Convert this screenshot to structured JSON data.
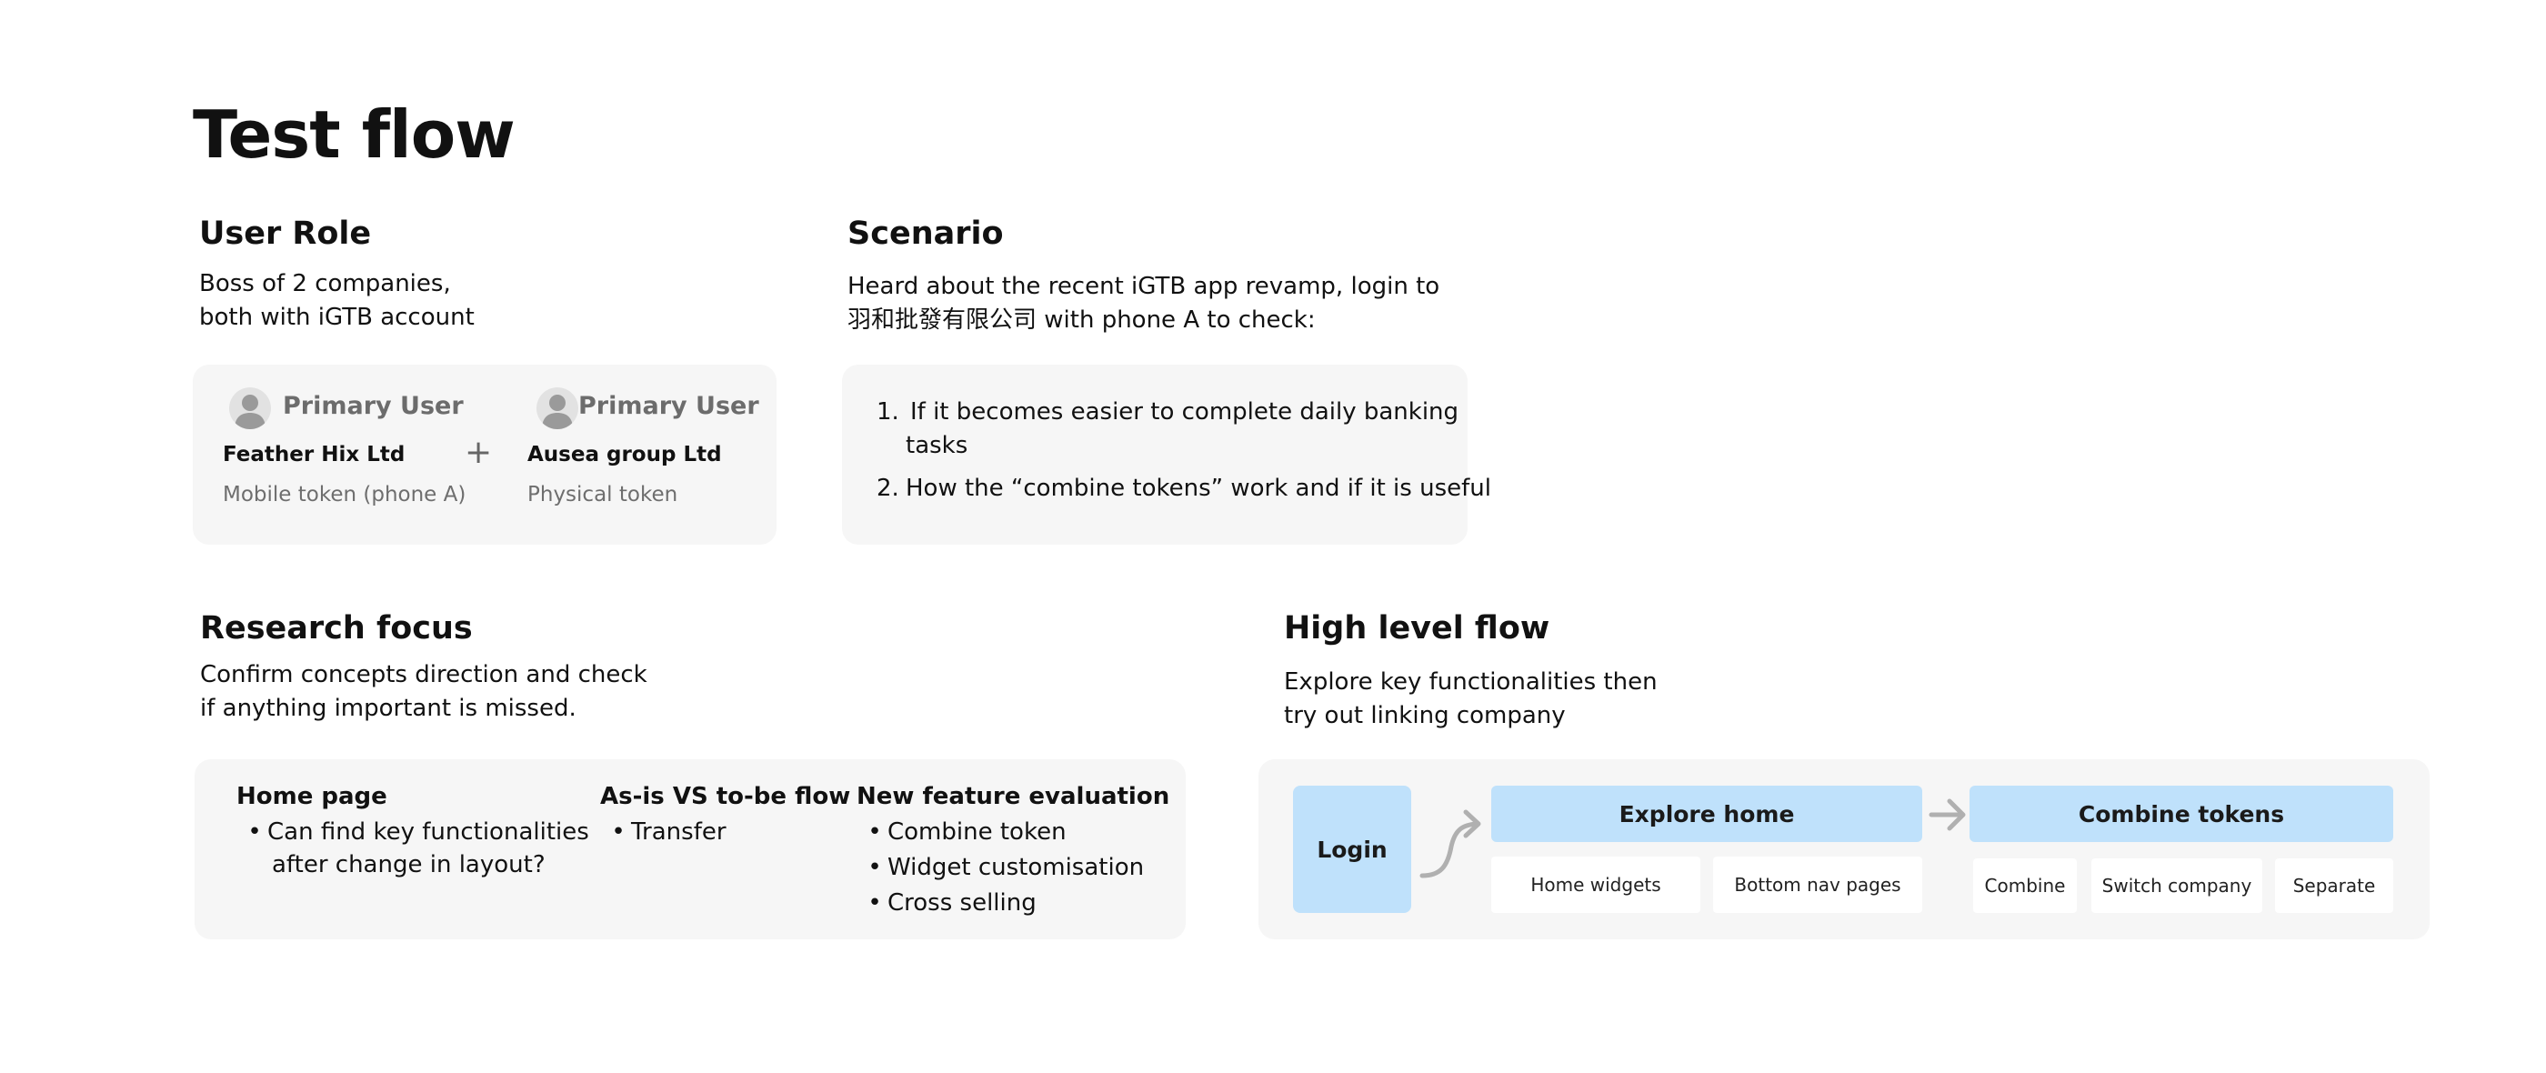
{
  "page": {
    "title": "Test flow"
  },
  "user_role": {
    "heading": "User Role",
    "description_line1": "Boss of 2 companies,",
    "description_line2": "both with iGTB account",
    "plus": "+",
    "users": [
      {
        "role": "Primary User",
        "company": "Feather Hix Ltd",
        "token": "Mobile token (phone A)"
      },
      {
        "role": "Primary User",
        "company": "Ausea group Ltd",
        "token": "Physical token"
      }
    ]
  },
  "scenario": {
    "heading": "Scenario",
    "description_line1": "Heard about the recent iGTB app revamp, login to",
    "description_line2": "羽和批發有限公司 with phone A  to check:",
    "items": [
      {
        "number": "1.",
        "line1": "If it becomes easier to complete daily banking",
        "line2": "tasks"
      },
      {
        "number": "2.",
        "line1": "How the “combine tokens” work and if it is useful"
      }
    ]
  },
  "research_focus": {
    "heading": "Research focus",
    "description_line1": "Confirm concepts direction and check",
    "description_line2": "if anything important is missed.",
    "bullet_char": "•",
    "columns": [
      {
        "title": "Home page",
        "items": [
          "Can find key functionalities",
          "after change in layout?"
        ]
      },
      {
        "title": "As-is VS to-be flow",
        "items": [
          "Transfer"
        ]
      },
      {
        "title": "New feature evaluation",
        "items": [
          "Combine token",
          "Widget customisation",
          "Cross selling"
        ]
      }
    ]
  },
  "high_level_flow": {
    "heading": "High level flow",
    "description_line1": "Explore key functionalities then",
    "description_line2": "try out linking company",
    "login": "Login",
    "explore_home": {
      "label": "Explore home",
      "subitems": [
        "Home widgets",
        "Bottom nav pages"
      ]
    },
    "combine_tokens": {
      "label": "Combine tokens",
      "subitems": [
        "Combine",
        "Switch company",
        "Separate"
      ]
    }
  },
  "colors": {
    "card_background": "#f6f6f6",
    "flow_step_blue": "#bfe1fb",
    "arrow_gray": "#b0b0b0",
    "muted_text": "#6e6e6e"
  }
}
